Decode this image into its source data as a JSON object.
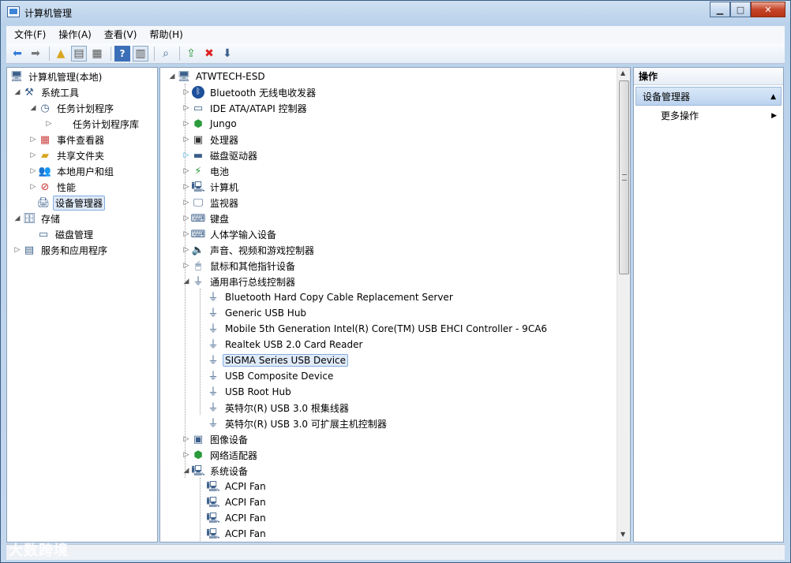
{
  "window": {
    "title": "计算机管理"
  },
  "menu": [
    "文件(F)",
    "操作(A)",
    "查看(V)",
    "帮助(H)"
  ],
  "toolbar": [
    "back-arrow-icon",
    "forward-arrow-icon",
    "up-folder-icon",
    "show-tree-icon",
    "properties-icon",
    "help-icon",
    "show-panel-icon",
    "scan-hardware-icon",
    "update-driver-icon",
    "uninstall-icon",
    "disable-icon"
  ],
  "tree": {
    "root": "计算机管理(本地)",
    "system_tools": "系统工具",
    "task_scheduler": "任务计划程序",
    "task_scheduler_lib": "任务计划程序库",
    "event_viewer": "事件查看器",
    "shared_folders": "共享文件夹",
    "local_users": "本地用户和组",
    "performance": "性能",
    "device_manager": "设备管理器",
    "storage": "存储",
    "disk_management": "磁盘管理",
    "services_apps": "服务和应用程序"
  },
  "devices": {
    "root": "ATWTECH-ESD",
    "categories": [
      "Bluetooth 无线电收发器",
      "IDE ATA/ATAPI 控制器",
      "Jungo",
      "处理器",
      "磁盘驱动器",
      "电池",
      "计算机",
      "监视器",
      "键盘",
      "人体学输入设备",
      "声音、视频和游戏控制器",
      "鼠标和其他指针设备",
      "通用串行总线控制器"
    ],
    "usb_children": [
      "Bluetooth Hard Copy Cable Replacement Server",
      "Generic USB Hub",
      "Mobile 5th Generation Intel(R) Core(TM) USB EHCI Controller - 9CA6",
      "Realtek USB 2.0 Card Reader",
      "SIGMA Series USB Device",
      "USB Composite Device",
      "USB Root Hub",
      "英特尔(R) USB 3.0 根集线器",
      "英特尔(R) USB 3.0 可扩展主机控制器"
    ],
    "more_categories": [
      "图像设备",
      "网络适配器",
      "系统设备"
    ],
    "system_children": [
      "ACPI Fan",
      "ACPI Fan",
      "ACPI Fan",
      "ACPI Fan"
    ]
  },
  "actions": {
    "header": "操作",
    "selected": "设备管理器",
    "more": "更多操作"
  },
  "watermark": "大数跨境"
}
